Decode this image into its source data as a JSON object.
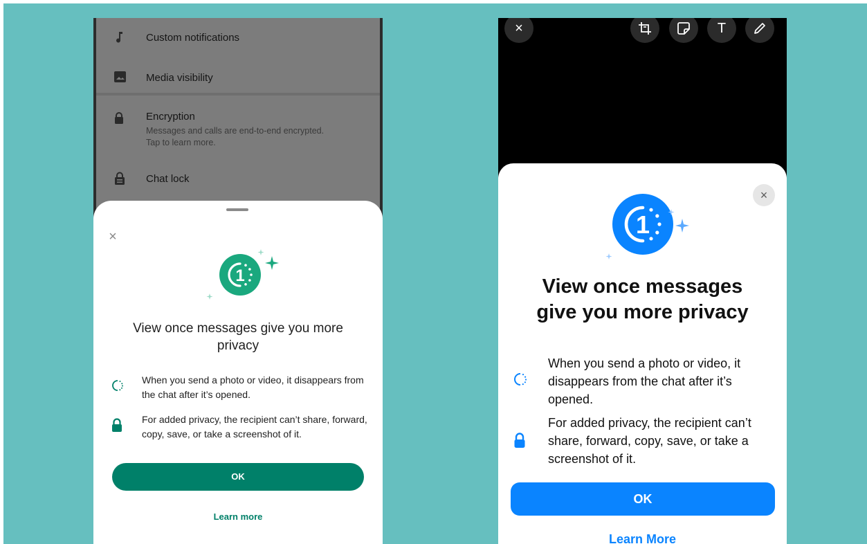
{
  "colors": {
    "background": "#66bfbf",
    "android_accent": "#008069",
    "android_badge": "#1aa87e",
    "ios_accent": "#0a84ff"
  },
  "android": {
    "settings": {
      "items": [
        {
          "icon": "music-note-icon",
          "label": "Custom notifications"
        },
        {
          "icon": "image-icon",
          "label": "Media visibility"
        },
        {
          "icon": "lock-icon",
          "label": "Encryption",
          "sublabel_line1": "Messages and calls are end-to-end encrypted.",
          "sublabel_line2": "Tap to learn more."
        },
        {
          "icon": "chat-lock-icon",
          "label": "Chat lock"
        }
      ]
    },
    "sheet": {
      "close_symbol": "×",
      "badge_digit": "1",
      "title": "View once messages give you more privacy",
      "rows": [
        {
          "icon": "view-once-dashed-circle-icon",
          "text": "When you send a photo or video, it disappears from the chat after it’s opened."
        },
        {
          "icon": "lock-icon",
          "text": "For added privacy, the recipient can’t share, forward, copy, save, or take a screenshot of it."
        }
      ],
      "ok_label": "OK",
      "learn_more_label": "Learn more"
    }
  },
  "ios": {
    "toolbar": {
      "close_symbol": "×",
      "text_symbol": "T"
    },
    "sheet": {
      "close_symbol": "×",
      "badge_digit": "1",
      "title_line1": "View once messages",
      "title_line2": "give you more privacy",
      "rows": [
        {
          "icon": "view-once-dashed-circle-icon",
          "text": "When you send a photo or video, it disappears from the chat after it’s opened."
        },
        {
          "icon": "lock-icon",
          "text": "For added privacy, the recipient can’t share, forward, copy, save, or take a screenshot of it."
        }
      ],
      "ok_label": "OK",
      "learn_more_label": "Learn More"
    }
  }
}
